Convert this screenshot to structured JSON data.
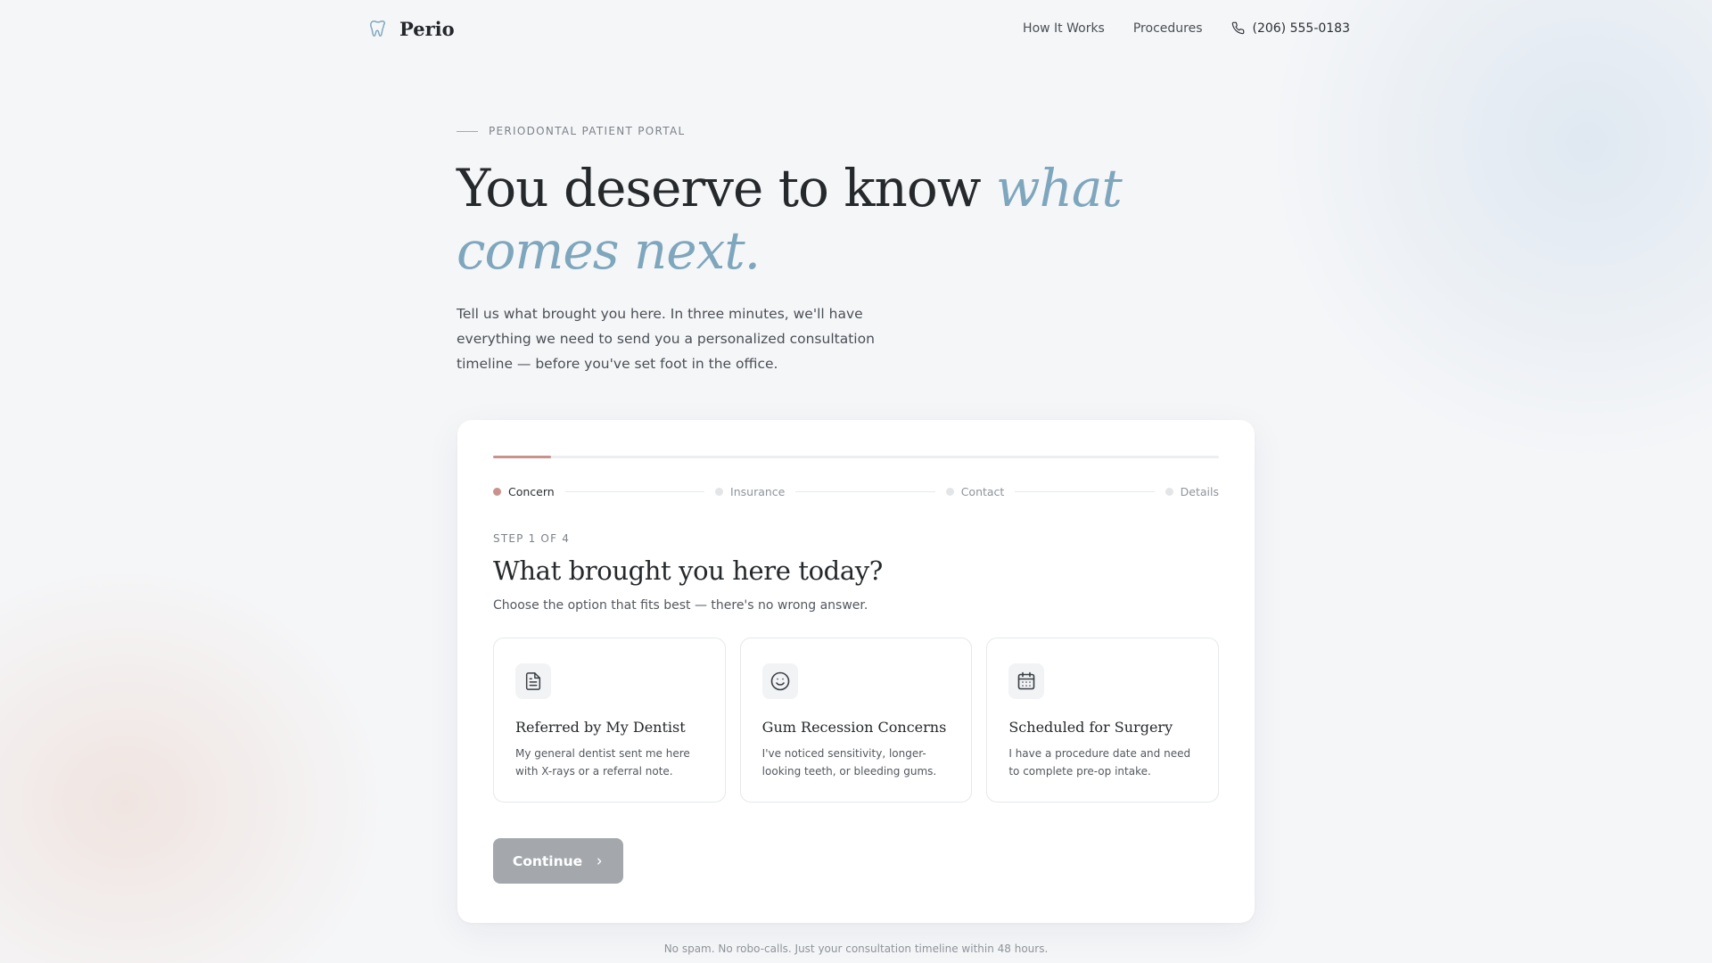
{
  "brand": {
    "name": "Perio",
    "icon": "tooth-icon"
  },
  "nav": {
    "links": [
      "How It Works",
      "Procedures"
    ],
    "phone": "(206) 555-0183",
    "phone_icon": "phone-icon"
  },
  "hero": {
    "eyebrow": "PERIODONTAL PATIENT PORTAL",
    "headline_plain": "You deserve to know ",
    "headline_accent": "what comes next.",
    "lede": "Tell us what brought you here. In three minutes, we'll have everything we need to send you a personalized consultation timeline — before you've set foot in the office."
  },
  "form": {
    "progress_fraction": 0.08,
    "steps": [
      {
        "label": "Concern",
        "active": true
      },
      {
        "label": "Insurance",
        "active": false
      },
      {
        "label": "Contact",
        "active": false
      },
      {
        "label": "Details",
        "active": false
      }
    ],
    "step_count": "STEP 1 OF 4",
    "question": "What brought you here today?",
    "hint": "Choose the option that fits best — there's no wrong answer.",
    "options": [
      {
        "icon": "document-icon",
        "title": "Referred by My Dentist",
        "desc": "My general dentist sent me here with X-rays or a referral note."
      },
      {
        "icon": "smile-icon",
        "title": "Gum Recession Concerns",
        "desc": "I've noticed sensitivity, longer-looking teeth, or bleeding gums."
      },
      {
        "icon": "calendar-icon",
        "title": "Scheduled for Surgery",
        "desc": "I have a procedure date and need to complete pre-op intake."
      }
    ],
    "continue_label": "Continue"
  },
  "footnote": "No spam. No robo-calls. Just your consultation timeline within 48 hours.",
  "colors": {
    "accent_rose": "#c9928d",
    "accent_blue": "#7ea6bd",
    "button_disabled": "#a4a8ad"
  }
}
